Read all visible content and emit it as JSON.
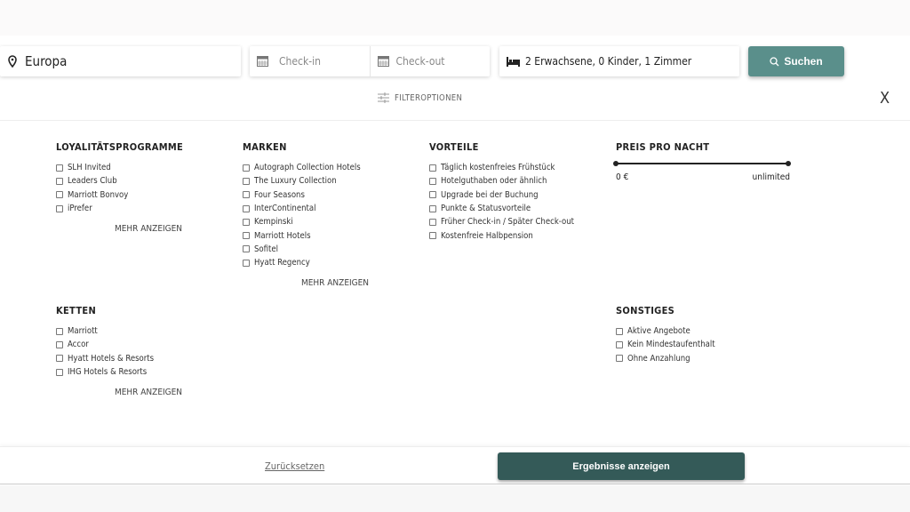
{
  "search": {
    "location": "Europa",
    "checkin_placeholder": "Check-in",
    "checkout_placeholder": "Check-out",
    "guests": "2 Erwachsene, 0 Kinder, 1 Zimmer",
    "search_label": "Suchen"
  },
  "filter": {
    "title": "FILTEROPTIONEN",
    "close": "X"
  },
  "sections": {
    "loyalty": {
      "title": "LOYALITÄTSPROGRAMME",
      "items": [
        "SLH Invited",
        "Leaders Club",
        "Marriott Bonvoy",
        "iPrefer"
      ],
      "more": "MEHR ANZEIGEN"
    },
    "brands": {
      "title": "MARKEN",
      "items": [
        "Autograph Collection Hotels",
        "The Luxury Collection",
        "Four Seasons",
        "InterContinental",
        "Kempinski",
        "Marriott Hotels",
        "Sofitel",
        "Hyatt Regency"
      ],
      "more": "MEHR ANZEIGEN"
    },
    "benefits": {
      "title": "VORTEILE",
      "items": [
        "Täglich kostenfreies Frühstück",
        "Hotelguthaben oder ähnlich",
        "Upgrade bei der Buchung",
        "Punkte & Statusvorteile",
        "Früher Check-in / Später Check-out",
        "Kostenfreie Halbpension"
      ]
    },
    "price": {
      "title": "PREIS PRO NACHT",
      "min": "0 €",
      "max": "unlimited"
    },
    "chains": {
      "title": "KETTEN",
      "items": [
        "Marriott",
        "Accor",
        "Hyatt Hotels & Resorts",
        "IHG Hotels & Resorts"
      ],
      "more": "MEHR ANZEIGEN"
    },
    "other": {
      "title": "SONSTIGES",
      "items": [
        "Aktive Angebote",
        "Kein Mindestaufenthalt",
        "Ohne Anzahlung"
      ]
    }
  },
  "footer": {
    "reset": "Zurücksetzen",
    "show_results": "Ergebnisse anzeigen"
  },
  "colors": {
    "search_button": "#5a8f8b",
    "results_button": "#345a58"
  }
}
